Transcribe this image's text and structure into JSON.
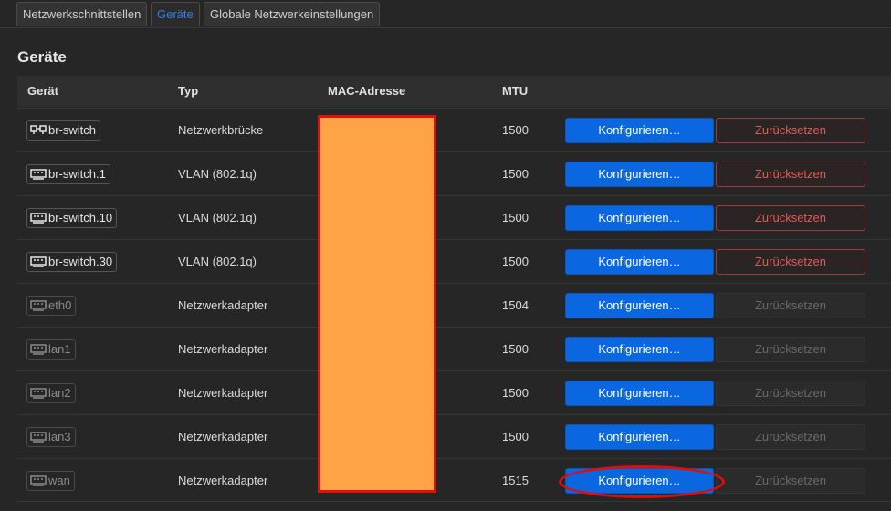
{
  "tabs": [
    {
      "label": "Netzwerkschnittstellen",
      "active": false
    },
    {
      "label": "Geräte",
      "active": true
    },
    {
      "label": "Globale Netzwerkeinstellungen",
      "active": false
    }
  ],
  "section": {
    "title": "Geräte"
  },
  "table": {
    "headers": {
      "device": "Gerät",
      "type": "Typ",
      "mac": "MAC-Adresse",
      "mtu": "MTU"
    },
    "rows": [
      {
        "device": "br-switch",
        "icon": "bridge-icon",
        "active": true,
        "type": "Netzwerkbrücke",
        "mtu": "1500",
        "configure": "Konfigurieren…",
        "reset": "Zurücksetzen",
        "reset_enabled": true
      },
      {
        "device": "br-switch.1",
        "icon": "ethernet-port-icon",
        "active": true,
        "type": "VLAN (802.1q)",
        "mtu": "1500",
        "configure": "Konfigurieren…",
        "reset": "Zurücksetzen",
        "reset_enabled": true
      },
      {
        "device": "br-switch.10",
        "icon": "ethernet-port-icon",
        "active": true,
        "type": "VLAN (802.1q)",
        "mtu": "1500",
        "configure": "Konfigurieren…",
        "reset": "Zurücksetzen",
        "reset_enabled": true
      },
      {
        "device": "br-switch.30",
        "icon": "ethernet-port-icon",
        "active": true,
        "type": "VLAN (802.1q)",
        "mtu": "1500",
        "configure": "Konfigurieren…",
        "reset": "Zurücksetzen",
        "reset_enabled": true
      },
      {
        "device": "eth0",
        "icon": "ethernet-port-icon",
        "active": false,
        "type": "Netzwerkadapter",
        "mtu": "1504",
        "configure": "Konfigurieren…",
        "reset": "Zurücksetzen",
        "reset_enabled": false
      },
      {
        "device": "lan1",
        "icon": "ethernet-port-icon",
        "active": false,
        "type": "Netzwerkadapter",
        "mtu": "1500",
        "configure": "Konfigurieren…",
        "reset": "Zurücksetzen",
        "reset_enabled": false
      },
      {
        "device": "lan2",
        "icon": "ethernet-port-icon",
        "active": false,
        "type": "Netzwerkadapter",
        "mtu": "1500",
        "configure": "Konfigurieren…",
        "reset": "Zurücksetzen",
        "reset_enabled": false
      },
      {
        "device": "lan3",
        "icon": "ethernet-port-icon",
        "active": false,
        "type": "Netzwerkadapter",
        "mtu": "1500",
        "configure": "Konfigurieren…",
        "reset": "Zurücksetzen",
        "reset_enabled": false
      },
      {
        "device": "wan",
        "icon": "ethernet-port-icon",
        "active": false,
        "type": "Netzwerkadapter",
        "mtu": "1515",
        "configure": "Konfigurieren…",
        "reset": "Zurücksetzen",
        "reset_enabled": false
      }
    ]
  },
  "colors": {
    "accent": "#0a67e0",
    "danger": "#e05a5a",
    "redaction_fill": "#ffa347",
    "annotation_red": "#e00d0d"
  }
}
